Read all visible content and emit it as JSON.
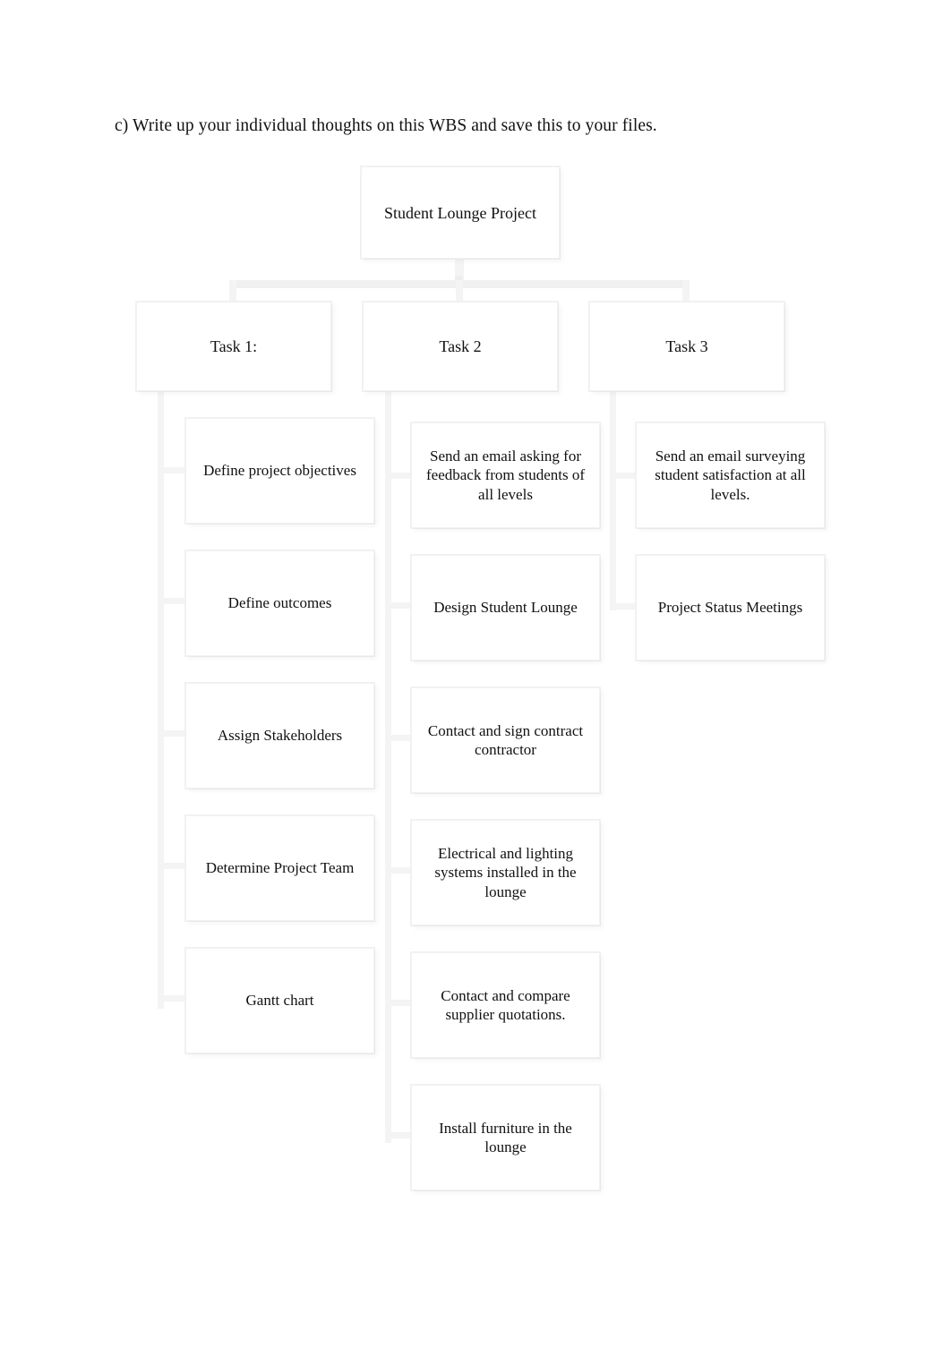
{
  "document": {
    "intro_text": "c) Write up your individual thoughts on this WBS and save this to your files."
  },
  "chart_data": {
    "type": "diagram",
    "diagram_kind": "work-breakdown-structure",
    "title": "Student Lounge Project",
    "root": {
      "label": "Student Lounge Project"
    },
    "branches": [
      {
        "label": "Task 1:",
        "children": [
          "Define project objectives",
          "Define outcomes",
          "Assign Stakeholders",
          "Determine Project Team",
          "Gantt chart"
        ]
      },
      {
        "label": "Task 2",
        "children": [
          "Send an email asking for feedback from students of all levels",
          "Design Student Lounge",
          "Contact and sign contract contractor",
          "Electrical and lighting systems installed in the lounge",
          "Contact and compare supplier quotations.",
          "Install furniture in the lounge"
        ]
      },
      {
        "label": "Task 3",
        "children": [
          "Send an email surveying student satisfaction at all levels.",
          "Project Status Meetings"
        ]
      }
    ],
    "colors": {
      "page_background": "#ffffff",
      "node_fill": "#ffffff",
      "node_border": "#f2f2f2",
      "connector": "#f4f4f4",
      "text": "#111111"
    }
  }
}
